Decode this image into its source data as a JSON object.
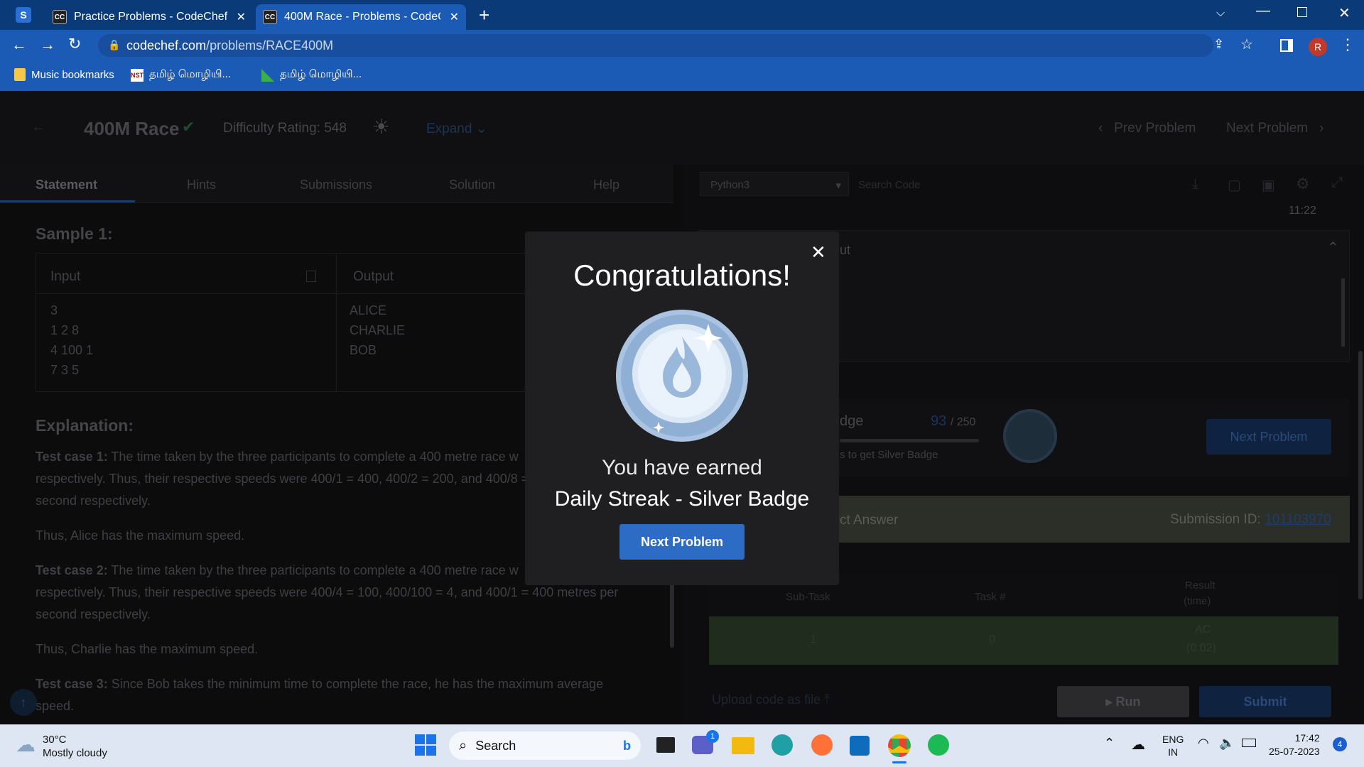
{
  "browser": {
    "tabs": [
      {
        "title": "Practice Problems - CodeChef"
      },
      {
        "title": "400M Race - Problems - CodeCh"
      }
    ],
    "url_host": "codechef.com",
    "url_path": "/problems/RACE400M",
    "profile_initial": "R",
    "bookmarks": [
      {
        "label": "Music bookmarks"
      },
      {
        "label": "தமிழ் மொழியி..."
      },
      {
        "label": "தமிழ் மொழியி..."
      }
    ]
  },
  "header": {
    "problem_title": "400M Race",
    "difficulty": "Difficulty Rating: 548",
    "expand": "Expand",
    "prev": "Prev Problem",
    "next": "Next Problem"
  },
  "tabs": [
    "Statement",
    "Hints",
    "Submissions",
    "Solution",
    "Help"
  ],
  "editor": {
    "language": "Python3",
    "search_placeholder": "Search Code",
    "time": "11:22",
    "output_label": "ut",
    "badge_label": "dge",
    "progress_current": "93",
    "progress_total": "/ 250",
    "badge_hint": "s to get Silver Badge",
    "next_problem": "Next Problem",
    "verdict": "ct Answer",
    "submission_label": "Submission ID:",
    "submission_id": "101103970",
    "table_headers": [
      "Sub-Task",
      "Task #",
      "Result",
      "(time)"
    ],
    "table_row": [
      "1",
      "0",
      "AC",
      "(0.02)"
    ],
    "upload": "Upload code as file",
    "run": "Run",
    "submit": "Submit"
  },
  "statement": {
    "sample_heading": "Sample 1:",
    "input_label": "Input",
    "output_label": "Output",
    "input_lines": [
      "3",
      "1 2 8",
      "4 100 1",
      "7 3 5"
    ],
    "output_lines": [
      "ALICE",
      "CHARLIE",
      "BOB"
    ],
    "explanation_heading": "Explanation:",
    "tc1_label": "Test case 1:",
    "tc1_text": "The time taken by the three participants to complete a 400 metre race w",
    "tc1_text2": "respectively. Thus, their respective speeds were 400/1 = 400, 400/2 = 200, and 400/8 = 5",
    "tc1_text3": "second respectively.",
    "tc1_conclusion": "Thus, Alice has the maximum speed.",
    "tc2_label": "Test case 2:",
    "tc2_text": "The time taken by the three participants to complete a 400 metre race w",
    "tc2_text2": "respectively. Thus, their respective speeds were 400/4 = 100, 400/100 = 4, and 400/1 = 400 metres per",
    "tc2_text3": "second respectively.",
    "tc2_conclusion": "Thus, Charlie has the maximum speed.",
    "tc3_label": "Test case 3:",
    "tc3_text": "Since Bob takes the minimum time to complete the race, he has the maximum average",
    "tc3_text2": "speed."
  },
  "modal": {
    "title": "Congratulations!",
    "earned": "You have earned",
    "badge": "Daily Streak - Silver Badge",
    "button": "Next Problem"
  },
  "taskbar": {
    "temp": "30°C",
    "weather": "Mostly cloudy",
    "search": "Search",
    "lang1": "ENG",
    "lang2": "IN",
    "time": "17:42",
    "date": "25-07-2023",
    "notif_count": "4",
    "teams_badge": "1"
  },
  "colors": {
    "accent": "#2c6cc4",
    "chrome_dark": "#0b3a78",
    "chrome": "#1c5bb5",
    "modal_bg": "#1f1f22"
  }
}
